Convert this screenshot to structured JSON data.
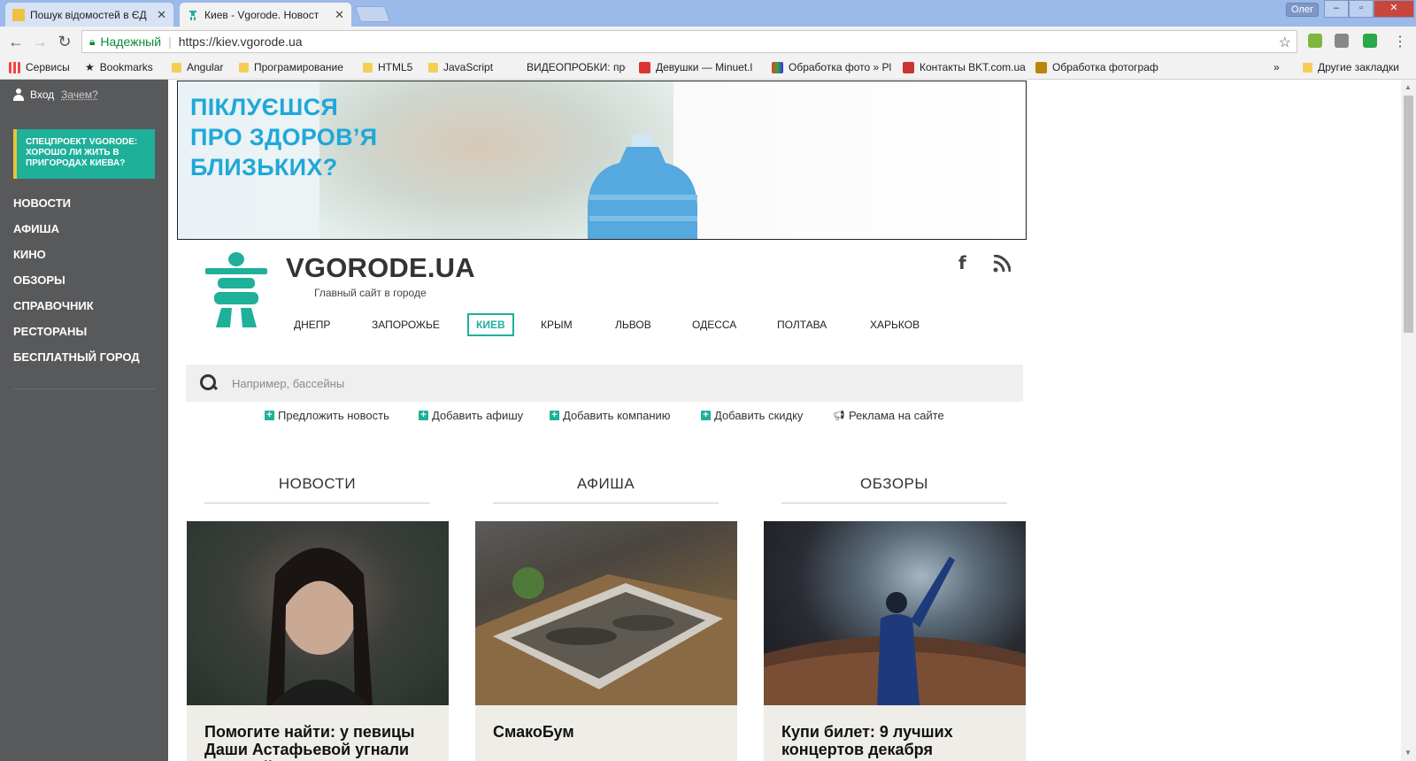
{
  "browser": {
    "tabs": [
      {
        "title": "Пошук відомостей в ЄД",
        "active": false
      },
      {
        "title": "Киев - Vgorode. Новост",
        "active": true
      }
    ],
    "window_user": "Олег",
    "secure_label": "Надежный",
    "url": "https://kiev.vgorode.ua",
    "bookmarks": [
      {
        "label": "Сервисы",
        "icon": "apps-grid-icon"
      },
      {
        "label": "Bookmarks",
        "icon": "star-icon"
      },
      {
        "label": "Angular",
        "icon": "folder-icon"
      },
      {
        "label": "Програмирование",
        "icon": "folder-icon"
      },
      {
        "label": "HTML5",
        "icon": "folder-icon"
      },
      {
        "label": "JavaScript",
        "icon": "folder-icon"
      },
      {
        "label": "ВИДЕОПРОБКИ: про",
        "icon": "none"
      },
      {
        "label": "Девушки — Minuet.l",
        "icon": "site-icon"
      },
      {
        "label": "Обработка фото » Pl",
        "icon": "site-icon"
      },
      {
        "label": "Контакты BKT.com.ua",
        "icon": "site-icon"
      },
      {
        "label": "Обработка фотограф",
        "icon": "site-icon"
      }
    ],
    "bookmarks_more": "»",
    "other_bookmarks": "Другие закладки"
  },
  "sidebar": {
    "login": "Вход",
    "why": "Зачем?",
    "promo": "СПЕЦПРОЕКТ VGORODE: ХОРОШО ЛИ ЖИТЬ В ПРИГОРОДАХ КИЕВА?",
    "nav": [
      "НОВОСТИ",
      "АФИША",
      "КИНО",
      "ОБЗОРЫ",
      "СПРАВОЧНИК",
      "РЕСТОРАНЫ",
      "БЕСПЛАТНЫЙ ГОРОД"
    ]
  },
  "ad": {
    "lines": [
      "ПІКЛУЄШСЯ",
      "ПРО ЗДОРОВ’Я",
      "БЛИЗЬКИХ?"
    ]
  },
  "header": {
    "brand": "VGORODE.UA",
    "tagline": "Главный сайт в городе",
    "social": [
      "facebook-icon",
      "rss-icon"
    ]
  },
  "cities": {
    "items": [
      "ДНЕПР",
      "ЗАПОРОЖЬЕ",
      "КИЕВ",
      "КРЫМ",
      "ЛЬВОВ",
      "ОДЕССА",
      "ПОЛТАВА",
      "ХАРЬКОВ"
    ],
    "active": "КИЕВ"
  },
  "search": {
    "placeholder": "Например, бассейны"
  },
  "actions": [
    "Предложить новость",
    "Добавить афишу",
    "Добавить компанию",
    "Добавить скидку",
    "Реклама на сайте"
  ],
  "columns": [
    {
      "title": "НОВОСТИ",
      "card_title": "Помогите найти: у певицы Даши Астафьевой угнали красный мерседес"
    },
    {
      "title": "АФИША",
      "card_title": "СмакоБум"
    },
    {
      "title": "ОБЗОРЫ",
      "card_title": "Купи билет: 9 лучших концертов декабря"
    }
  ],
  "colors": {
    "accent": "#1fb09a",
    "sidebar": "#58595b",
    "promo_border": "#e7c43a",
    "ad_text": "#1fa8d8"
  }
}
